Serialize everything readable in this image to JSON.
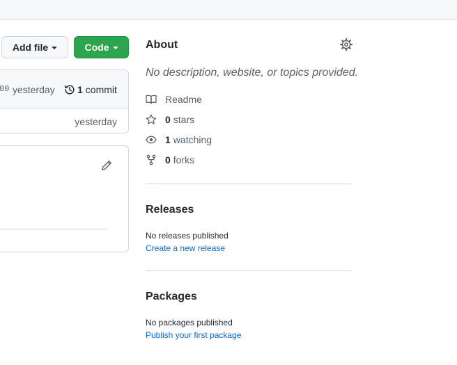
{
  "toolbar": {
    "add_file_label": "Add file",
    "code_label": "Code"
  },
  "commit": {
    "hash_fragment": "00",
    "time": "yesterday",
    "count": "1",
    "count_label": "commit",
    "file_time": "yesterday"
  },
  "about": {
    "title": "About",
    "description": "No description, website, or topics provided.",
    "readme_label": "Readme",
    "stars_count": "0",
    "stars_label": "stars",
    "watching_count": "1",
    "watching_label": "watching",
    "forks_count": "0",
    "forks_label": "forks"
  },
  "releases": {
    "title": "Releases",
    "empty_text": "No releases published",
    "create_link": "Create a new release"
  },
  "packages": {
    "title": "Packages",
    "empty_text": "No packages published",
    "publish_link": "Publish your first package"
  },
  "colors": {
    "accent_green": "#2da44e",
    "link_blue": "#0969da",
    "muted_text": "#57606a",
    "border": "#d0d7de"
  },
  "icons": [
    "history-icon",
    "pencil-icon",
    "gear-icon",
    "book-icon",
    "star-icon",
    "eye-icon",
    "fork-icon"
  ]
}
